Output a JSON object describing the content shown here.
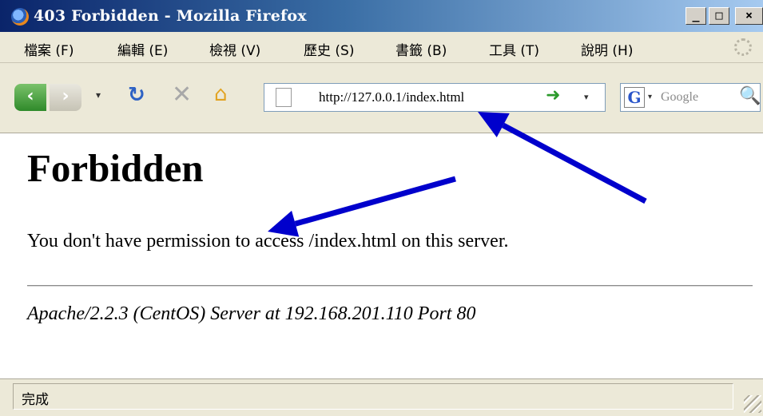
{
  "window": {
    "title": "403 Forbidden - Mozilla Firefox",
    "controls": {
      "minimize": "_",
      "maximize": "□",
      "close": "×"
    }
  },
  "menu": [
    {
      "label": "檔案 (F)"
    },
    {
      "label": "編輯 (E)"
    },
    {
      "label": "檢視 (V)"
    },
    {
      "label": "歷史 (S)"
    },
    {
      "label": "書籤 (B)"
    },
    {
      "label": "工具 (T)"
    },
    {
      "label": "說明 (H)"
    }
  ],
  "toolbar": {
    "icons": [
      "back-icon",
      "forward-icon",
      "reload-icon",
      "stop-icon",
      "home-icon"
    ],
    "back_glyph": "‹",
    "forward_glyph": "›",
    "reload_glyph": "↻",
    "stop_glyph": "✕",
    "home_glyph": "⌂",
    "dropdown_glyph": "▾"
  },
  "address_bar": {
    "url": "http://127.0.0.1/index.html",
    "go_glyph": "➜"
  },
  "search": {
    "engine_glyph": "G",
    "placeholder": "Google",
    "search_glyph": "🔍"
  },
  "page": {
    "heading": "Forbidden",
    "message": "You don't have permission to access /index.html on this server.",
    "address": "Apache/2.2.3 (CentOS) Server at 192.168.201.110 Port 80"
  },
  "annotations": {
    "arrow_color": "#0000cc"
  },
  "status": {
    "text": "完成"
  },
  "colors": {
    "title_bar": "#0a246a",
    "chrome": "#ece9d8",
    "content_bg": "#ffffff"
  }
}
